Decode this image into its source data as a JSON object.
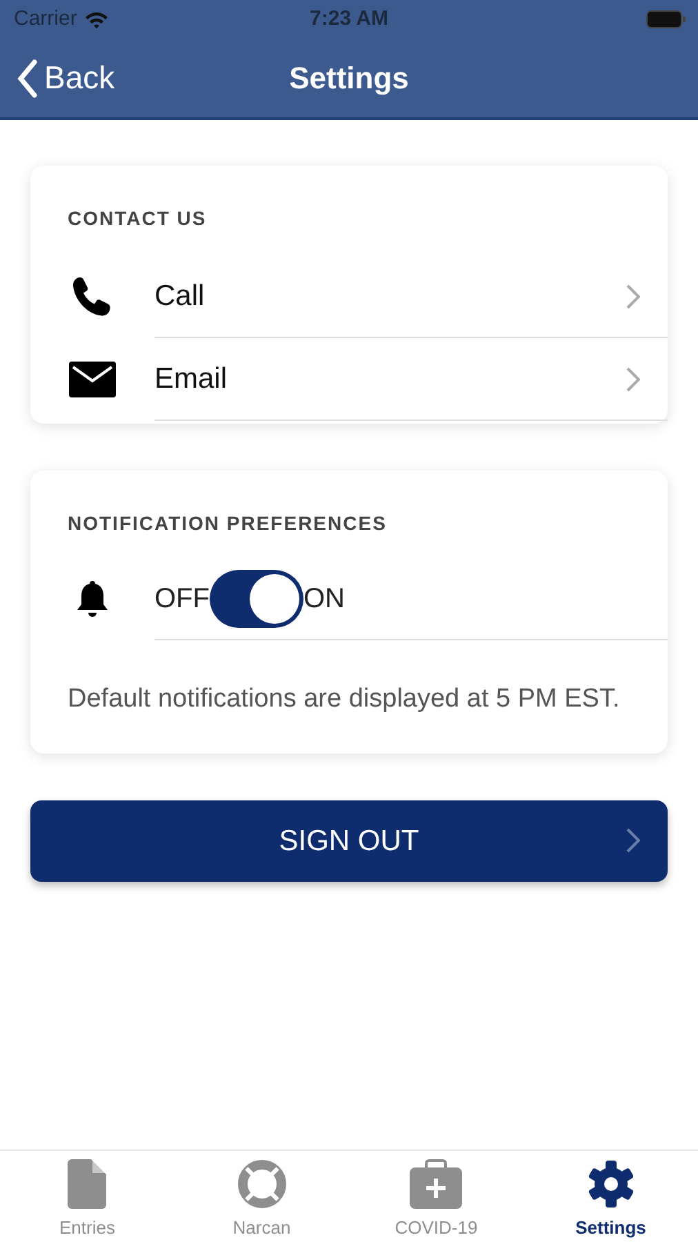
{
  "status_bar": {
    "carrier": "Carrier",
    "time": "7:23 AM"
  },
  "nav": {
    "back": "Back",
    "title": "Settings"
  },
  "contact": {
    "heading": "CONTACT US",
    "items": [
      {
        "kind": "phone",
        "label": "Call"
      },
      {
        "kind": "email",
        "label": "Email"
      }
    ]
  },
  "notifications": {
    "heading": "NOTIFICATION PREFERENCES",
    "off_label": "OFF",
    "on_label": "ON",
    "on": true,
    "note": "Default notifications are displayed at 5 PM EST."
  },
  "sign_out": "SIGN OUT",
  "tabs": [
    {
      "kind": "entries",
      "label": "Entries",
      "selected": false
    },
    {
      "kind": "narcan",
      "label": "Narcan",
      "selected": false
    },
    {
      "kind": "covid",
      "label": "COVID-19",
      "selected": false
    },
    {
      "kind": "settings",
      "label": "Settings",
      "selected": true
    }
  ]
}
